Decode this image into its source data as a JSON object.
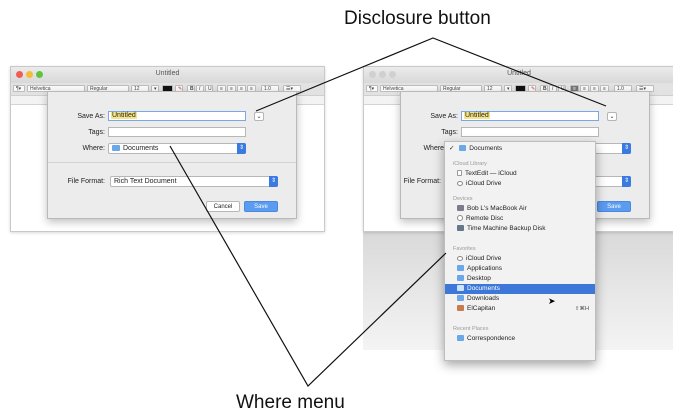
{
  "callouts": {
    "disclosure": "Disclosure button",
    "where_menu": "Where menu"
  },
  "window": {
    "title": "Untitled",
    "font_family": "Helvetica",
    "font_style": "Regular",
    "font_size": "12",
    "line_spacing": "1.0"
  },
  "save_sheet": {
    "save_as_label": "Save As:",
    "save_as_value": "Untitled",
    "tags_label": "Tags:",
    "tags_value": "",
    "where_label": "Where:",
    "where_value": "Documents",
    "file_format_label": "File Format:",
    "file_format_value": "Rich Text Document",
    "cancel_label": "Cancel",
    "save_label": "Save"
  },
  "where_menu": {
    "checked": "✓",
    "current": "Documents",
    "sections": [
      {
        "header": "iCloud Library",
        "items": [
          {
            "label": "TextEdit — iCloud",
            "icon": "document-icon"
          },
          {
            "label": "iCloud Drive",
            "icon": "cloud-icon"
          }
        ]
      },
      {
        "header": "Devices",
        "items": [
          {
            "label": "Bob L's MacBook Air",
            "icon": "laptop-icon"
          },
          {
            "label": "Remote Disc",
            "icon": "disc-icon"
          },
          {
            "label": "Time Machine Backup Disk",
            "icon": "drive-icon"
          }
        ]
      },
      {
        "header": "Favorites",
        "items": [
          {
            "label": "iCloud Drive",
            "icon": "cloud-icon"
          },
          {
            "label": "Applications",
            "icon": "folder-icon"
          },
          {
            "label": "Desktop",
            "icon": "folder-icon"
          },
          {
            "label": "Documents",
            "icon": "folder-icon",
            "selected": true
          },
          {
            "label": "Downloads",
            "icon": "folder-icon"
          },
          {
            "label": "ElCapitan",
            "icon": "home-icon",
            "shortcut": "⇧⌘H"
          }
        ]
      },
      {
        "header": "Recent Places",
        "items": [
          {
            "label": "Correspondence",
            "icon": "folder-icon"
          }
        ]
      }
    ]
  },
  "colors": {
    "accent": "#3d78d8",
    "save_button": "#5b9bf0",
    "name_highlight": "#f5e58a"
  }
}
